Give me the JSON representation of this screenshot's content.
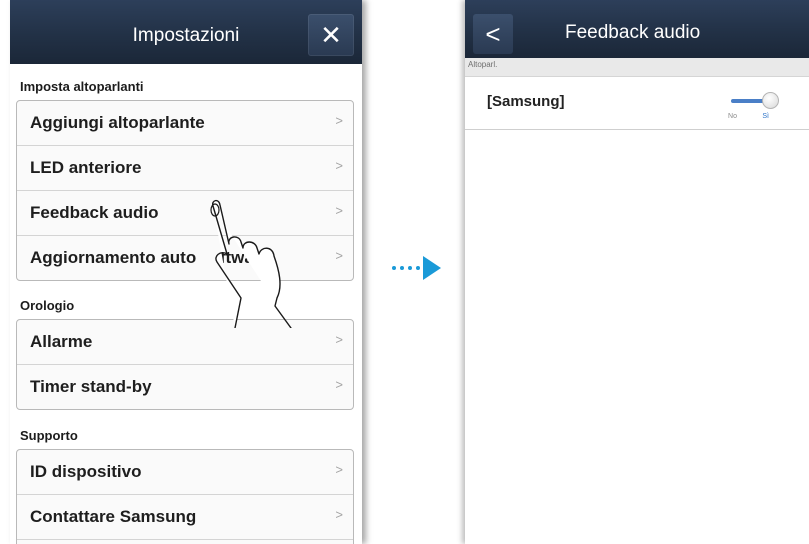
{
  "left_screen": {
    "title": "Impostazioni",
    "close_icon": "✕",
    "sections": [
      {
        "header": "Imposta altoparlanti",
        "items": [
          {
            "label": "Aggiungi altoparlante"
          },
          {
            "label": "LED anteriore"
          },
          {
            "label": "Feedback audio"
          },
          {
            "label": "Aggiornamento auto     ftware"
          }
        ]
      },
      {
        "header": "Orologio",
        "items": [
          {
            "label": "Allarme"
          },
          {
            "label": "Timer stand-by"
          }
        ]
      },
      {
        "header": "Supporto",
        "items": [
          {
            "label": "ID dispositivo"
          },
          {
            "label": "Contattare Samsung"
          }
        ]
      }
    ],
    "chevron": ">"
  },
  "arrow": {
    "color": "#1a9ad8"
  },
  "right_screen": {
    "title": "Feedback audio",
    "back_icon": "<",
    "sub_header": "Altoparl.",
    "device_name": "[Samsung]",
    "toggle": {
      "off_label": "No",
      "on_label": "Sì",
      "state": "on"
    }
  },
  "colors": {
    "topbar": "#223146",
    "toggle_accent": "#4a7fc7"
  }
}
